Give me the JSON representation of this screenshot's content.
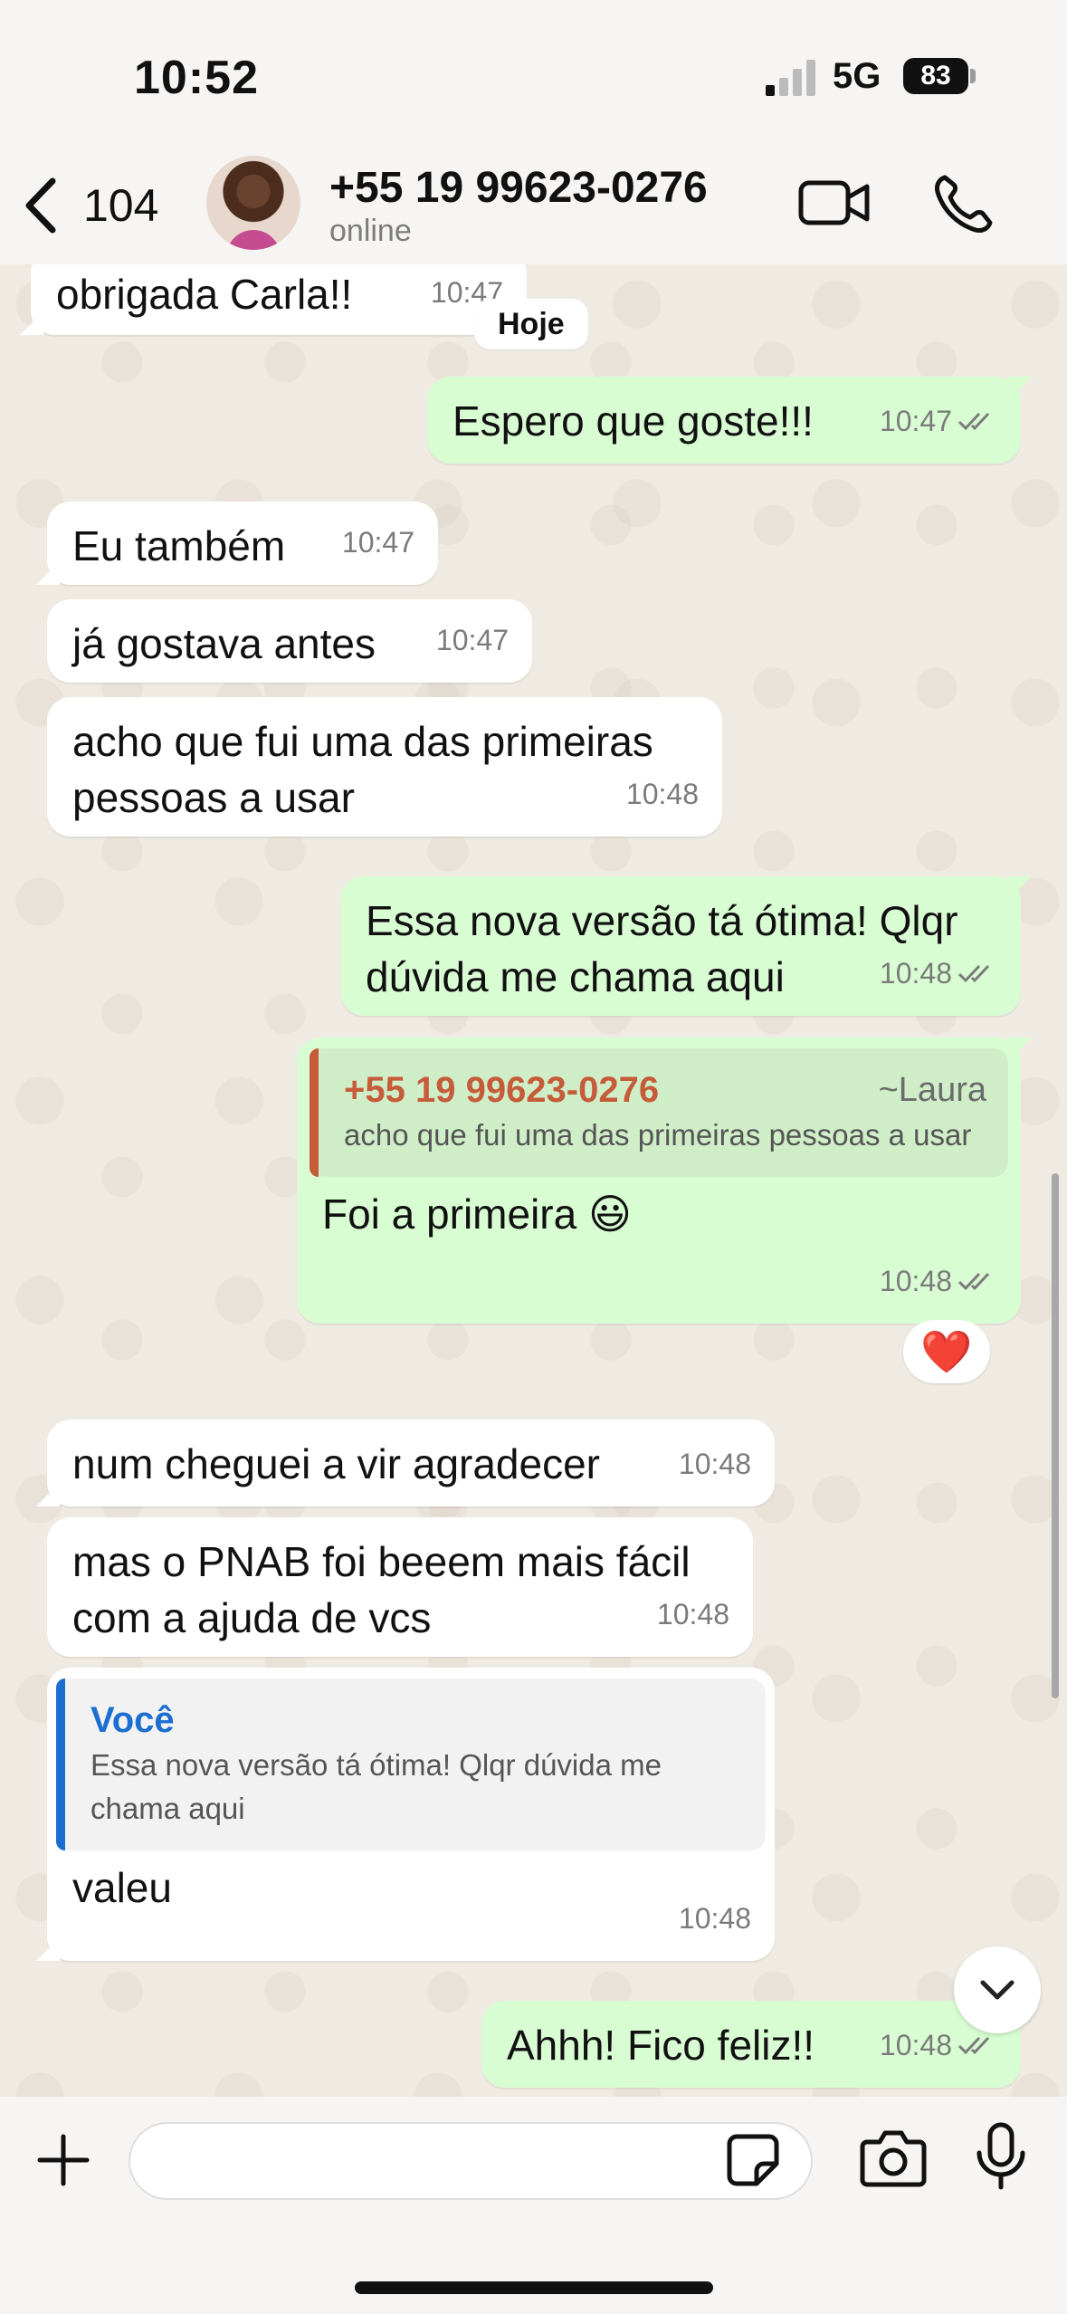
{
  "status_bar": {
    "time": "10:52",
    "network": "5G",
    "battery": "83"
  },
  "header": {
    "back_count": "104",
    "contact_name": "+55 19 99623-0276",
    "contact_status": "online"
  },
  "day_label": "Hoje",
  "messages": [
    {
      "direction": "in",
      "text": "obrigada Carla!!",
      "time": "10:47"
    },
    {
      "direction": "out",
      "text": "Espero que goste!!!",
      "time": "10:47",
      "read": true
    },
    {
      "direction": "in",
      "text": "Eu também",
      "time": "10:47"
    },
    {
      "direction": "in",
      "text": "já gostava antes",
      "time": "10:47"
    },
    {
      "direction": "in",
      "text": "acho que fui uma das primeiras pessoas a usar",
      "time": "10:48"
    },
    {
      "direction": "out",
      "text": "Essa nova versão tá ótima! Qlqr dúvida me chama aqui",
      "time": "10:48",
      "read": true
    },
    {
      "direction": "out",
      "quote": {
        "author": "+55 19 99623-0276",
        "alias": "~Laura",
        "text": "acho que fui uma das primeiras pessoas a usar"
      },
      "text": "Foi a primeira 😃",
      "time": "10:48",
      "read": true,
      "reaction": "❤️"
    },
    {
      "direction": "in",
      "text": "num cheguei a vir agradecer",
      "time": "10:48"
    },
    {
      "direction": "in",
      "text": "mas o PNAB foi beeem mais fácil com a ajuda de vcs",
      "time": "10:48"
    },
    {
      "direction": "in",
      "quote": {
        "author": "Você",
        "text": "Essa nova versão tá ótima! Qlqr dúvida me chama aqui"
      },
      "text": "valeu",
      "time": "10:48"
    },
    {
      "direction": "out",
      "text": "Ahhh! Fico feliz!!",
      "time": "10:48",
      "read": true
    }
  ],
  "input": {
    "placeholder": ""
  },
  "colors": {
    "incoming_bubble": "#ffffff",
    "outgoing_bubble": "#d9fdd3",
    "quote_in_bar": "#1a6fd0",
    "quote_out_bar": "#c65b3a",
    "chat_bg": "#efeae2"
  },
  "icons": [
    "back-chevron-icon",
    "video-call-icon",
    "phone-call-icon",
    "plus-icon",
    "sticker-icon",
    "camera-icon",
    "microphone-icon",
    "chevron-down-icon",
    "read-ticks-icon",
    "heart-icon"
  ]
}
